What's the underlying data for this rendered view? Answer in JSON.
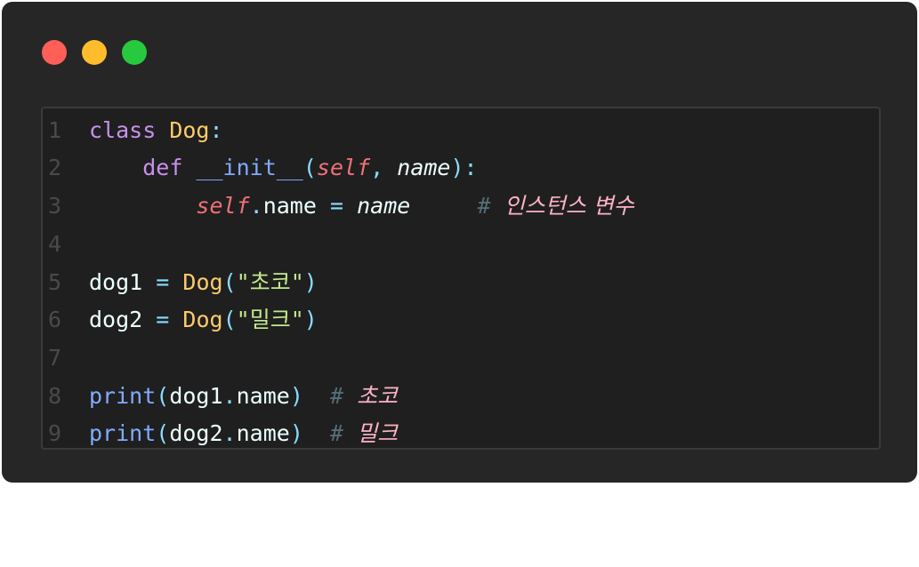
{
  "window": {
    "controls": [
      "close",
      "minimize",
      "maximize"
    ]
  },
  "code": {
    "line_numbers": [
      "1",
      "2",
      "3",
      "4",
      "5",
      "6",
      "7",
      "8",
      "9"
    ],
    "l1": {
      "kw": "class",
      "cls": "Dog",
      "colon": ":"
    },
    "l2": {
      "kw": "def",
      "fn": "__init__",
      "open": "(",
      "self": "self",
      "comma": ",",
      "param": "name",
      "close": "):"
    },
    "l3": {
      "self": "self",
      "dot": ".",
      "attr": "name",
      "eq": "=",
      "val": "name",
      "hash": "#",
      "comment": "인스턴스 변수"
    },
    "l5": {
      "var": "dog1",
      "eq": "=",
      "cls": "Dog",
      "open": "(",
      "q1": "\"",
      "str": "초코",
      "q2": "\"",
      "close": ")"
    },
    "l6": {
      "var": "dog2",
      "eq": "=",
      "cls": "Dog",
      "open": "(",
      "q1": "\"",
      "str": "밀크",
      "q2": "\"",
      "close": ")"
    },
    "l8": {
      "fn": "print",
      "open": "(",
      "obj": "dog1",
      "dot": ".",
      "attr": "name",
      "close": ")",
      "hash": "#",
      "comment": "초코"
    },
    "l9": {
      "fn": "print",
      "open": "(",
      "obj": "dog2",
      "dot": ".",
      "attr": "name",
      "close": ")",
      "hash": "#",
      "comment": "밀크"
    }
  },
  "colors": {
    "background": "#262626",
    "keyword": "#c792ea",
    "class_name": "#ffcb6b",
    "function": "#82aaff",
    "self": "#f07178",
    "string": "#c3e88d",
    "comment_text": "#ffb3c6",
    "line_number": "#4a4a4a"
  }
}
